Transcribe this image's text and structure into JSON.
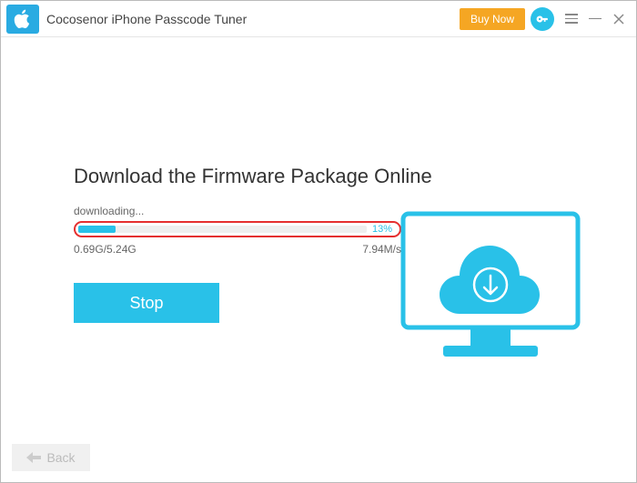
{
  "titlebar": {
    "app_title": "Cocosenor iPhone Passcode Tuner",
    "buy_now_label": "Buy Now"
  },
  "main": {
    "heading": "Download the Firmware Package Online",
    "status_text": "downloading...",
    "progress": {
      "percent": 13,
      "percent_label": "13%",
      "downloaded_label": "0.69G/5.24G",
      "speed_label": "7.94M/s"
    },
    "stop_label": "Stop"
  },
  "footer": {
    "back_label": "Back"
  },
  "colors": {
    "accent": "#29c1e8",
    "highlight_ring": "#e52f2f",
    "buy_now": "#f5a623"
  }
}
